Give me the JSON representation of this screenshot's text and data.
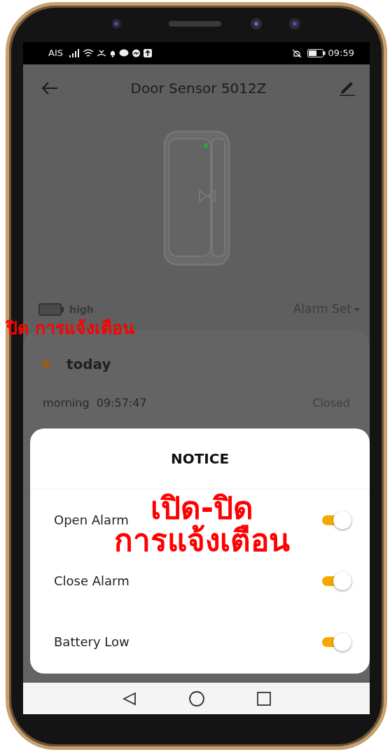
{
  "status_bar": {
    "carrier": "AIS",
    "time": "09:59"
  },
  "header": {
    "title": "Door Sensor 5012Z"
  },
  "battery": {
    "label": "high"
  },
  "alarm_set": {
    "label": "Alarm Set"
  },
  "log": {
    "day": "today",
    "entries": [
      {
        "period": "morning",
        "time": "09:57:47",
        "state": "Closed"
      }
    ]
  },
  "dialog": {
    "title": "NOTICE",
    "options": [
      {
        "label": "Open Alarm",
        "on": true
      },
      {
        "label": "Close Alarm",
        "on": true
      },
      {
        "label": "Battery Low",
        "on": true
      }
    ]
  },
  "side_annotation": "ปิด การแจ้งเตือน",
  "center_annotation": [
    "เปิด-ปิด",
    "การแจ้งเตือน"
  ]
}
